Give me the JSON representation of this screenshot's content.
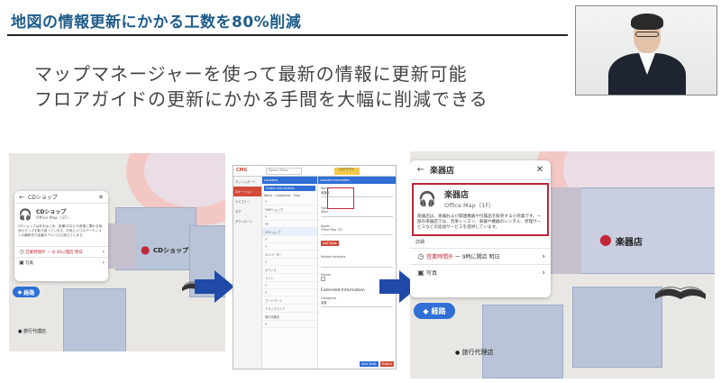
{
  "slide": {
    "title": "地図の情報更新にかかる工数を80%削減",
    "subtitle_line1": "マップマネージャーを使って最新の情報に更新可能",
    "subtitle_line2": "フロアガイドの更新にかかる手間を大幅に削減できる"
  },
  "colors": {
    "accent": "#1f5c8a",
    "route": "#2f6fd6",
    "pin": "#c0283a",
    "arrow": "#1f4aa8",
    "cms_red": "#d14a3a"
  },
  "before": {
    "search_value": "CDショップ",
    "place_name": "CDショップ",
    "place_sub": "Office Map（1F）",
    "description": "CDショップは本をはじめ、各種CDなどの音楽に関わる商品やグッズを取り扱っています。お気に入りのアーティストの最新作や定番のアルバムも揃えています。",
    "hours": "営業時間外 ー 8:30に開店 明日",
    "photos": "写真",
    "route_label": "経路",
    "pin_label": "CDショップ",
    "map_label": "旅行代理店"
  },
  "cms": {
    "header_title": "CMS",
    "header_search": "Demo Office",
    "header_btn": "ログアウト",
    "sidebar": [
      "ダッシュボード",
      "ロケーション",
      "カテゴリー",
      "タグ",
      "ダウンロード"
    ],
    "list_title": "Locations",
    "list_btn": "Create new location",
    "list_tabs": [
      "Name",
      "Categories",
      "Type"
    ],
    "list_items": [
      "Y",
      "YWPショップ",
      "Y",
      "YY",
      "CDショップ",
      "Y",
      "Y",
      "エレベーター",
      "Y",
      "オフィス",
      "トイレ",
      "Y",
      "Y",
      "フードコート",
      "ドラッグストア",
      "旅行代理店",
      "Y"
    ],
    "form_title": "Location Information",
    "form_fields": [
      "Name",
      "Type",
      "Nodes",
      "Related locations",
      "Hidden",
      "Categories"
    ],
    "form_ext": "Extended Information",
    "form_values": [
      "楽器店",
      "Store",
      "Office Map 1(F)",
      "楽器"
    ],
    "add_btn": "Add Node",
    "save_btn": "Save Draft",
    "publish_btn": "Publish"
  },
  "after": {
    "search_value": "楽器店",
    "place_name": "楽器店",
    "place_sub": "Office Map（1F）",
    "description": "楽器店は、楽器および関連機器や付属品を販売する小売業です。一部の楽器店では、音楽レッスン、楽器や機器のレンタル、修理サービスなどの追加サービスを提供しています。",
    "more": "詳細",
    "hours_status": "営業時間外",
    "hours_rest": " ー 9時に開店 明日",
    "photos": "写真",
    "route_label": "経路",
    "pin_label": "楽器店",
    "map_label": "旅行代理店"
  }
}
